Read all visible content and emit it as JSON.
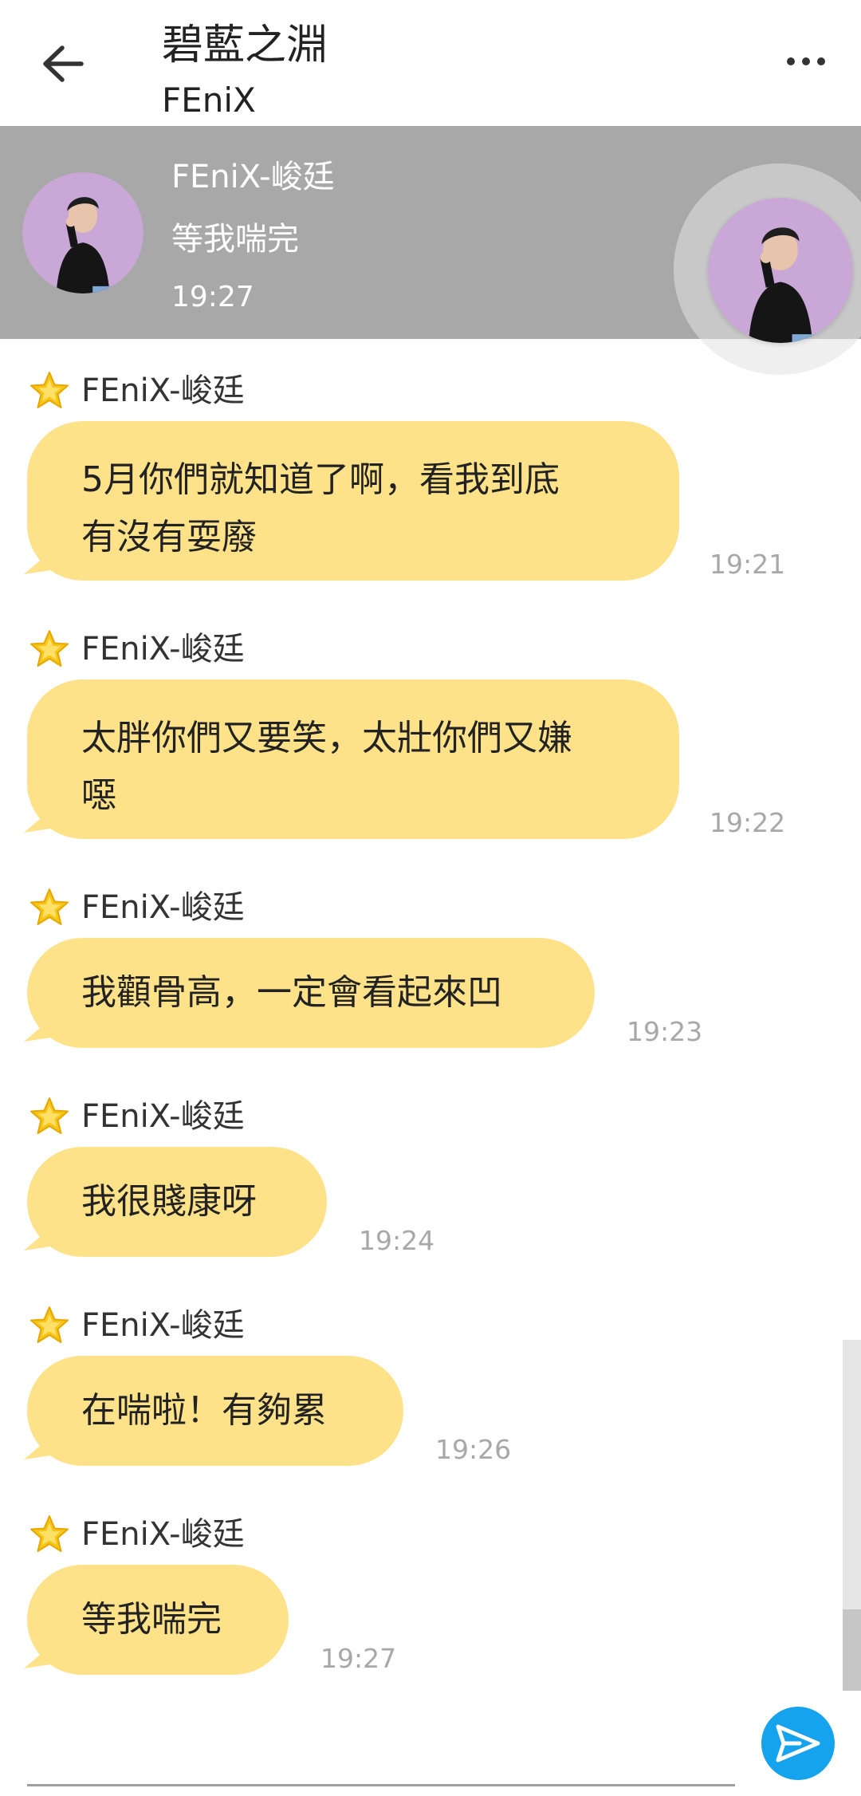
{
  "header": {
    "title": "碧藍之淵",
    "subtitle": "FEniX"
  },
  "pinned": {
    "name": "FEniX-峻廷",
    "text": "等我喘完",
    "time": "19:27"
  },
  "messages": [
    {
      "sender": "FEniX-峻廷",
      "lines": [
        "5月你們就知道了啊，看我到底",
        "有沒有耍廢"
      ],
      "time": "19:21"
    },
    {
      "sender": "FEniX-峻廷",
      "lines": [
        "太胖你們又要笑，太壯你們又嫌",
        "噁"
      ],
      "time": "19:22"
    },
    {
      "sender": "FEniX-峻廷",
      "lines": [
        "我顴骨高，一定會看起來凹"
      ],
      "time": "19:23"
    },
    {
      "sender": "FEniX-峻廷",
      "lines": [
        "我很賤康呀"
      ],
      "time": "19:24"
    },
    {
      "sender": "FEniX-峻廷",
      "lines": [
        "在喘啦！有夠累"
      ],
      "time": "19:26"
    },
    {
      "sender": "FEniX-峻廷",
      "lines": [
        "等我喘完"
      ],
      "time": "19:27"
    }
  ],
  "icons": {
    "back": "arrow-left-icon",
    "more": "more-horizontal-icon",
    "star": "star-badge-icon",
    "send": "send-icon"
  },
  "colors": {
    "bubble": "#fde28a",
    "banner": "#a8a8a8",
    "send": "#14a3ec",
    "star": "#f5c518"
  }
}
